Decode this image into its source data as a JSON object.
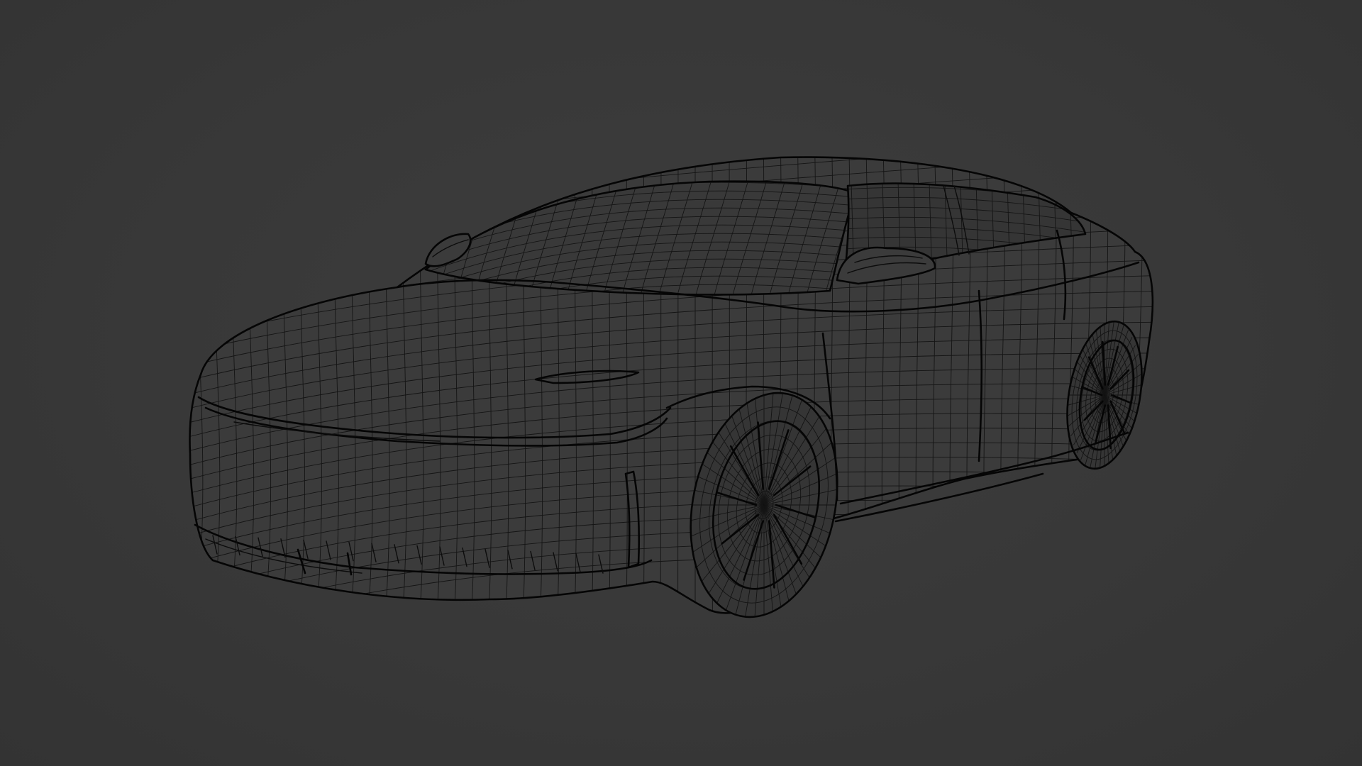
{
  "scene": {
    "background_color": "#3a3a3a",
    "wire_color": "#0c0c0c",
    "subject": "car-wireframe-mesh",
    "shading": "wireframe"
  }
}
